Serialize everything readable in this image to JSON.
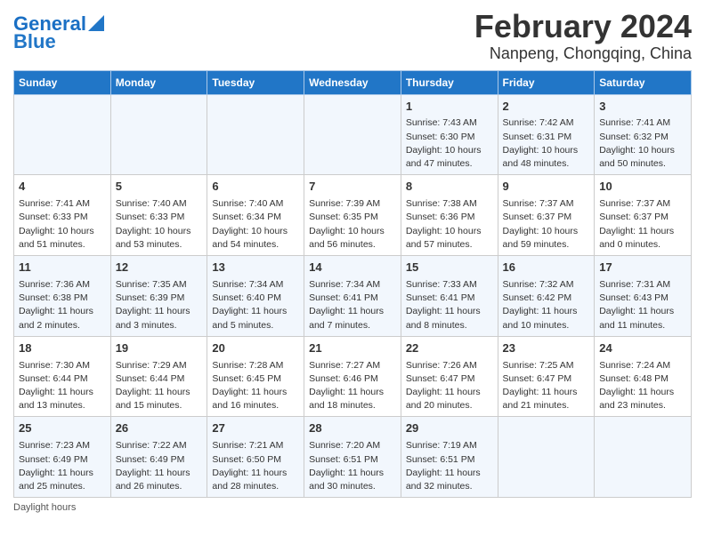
{
  "header": {
    "logo_line1": "General",
    "logo_line2": "Blue",
    "month": "February 2024",
    "location": "Nanpeng, Chongqing, China"
  },
  "days_of_week": [
    "Sunday",
    "Monday",
    "Tuesday",
    "Wednesday",
    "Thursday",
    "Friday",
    "Saturday"
  ],
  "weeks": [
    [
      {
        "day": "",
        "info": ""
      },
      {
        "day": "",
        "info": ""
      },
      {
        "day": "",
        "info": ""
      },
      {
        "day": "",
        "info": ""
      },
      {
        "day": "1",
        "info": "Sunrise: 7:43 AM\nSunset: 6:30 PM\nDaylight: 10 hours and 47 minutes."
      },
      {
        "day": "2",
        "info": "Sunrise: 7:42 AM\nSunset: 6:31 PM\nDaylight: 10 hours and 48 minutes."
      },
      {
        "day": "3",
        "info": "Sunrise: 7:41 AM\nSunset: 6:32 PM\nDaylight: 10 hours and 50 minutes."
      }
    ],
    [
      {
        "day": "4",
        "info": "Sunrise: 7:41 AM\nSunset: 6:33 PM\nDaylight: 10 hours and 51 minutes."
      },
      {
        "day": "5",
        "info": "Sunrise: 7:40 AM\nSunset: 6:33 PM\nDaylight: 10 hours and 53 minutes."
      },
      {
        "day": "6",
        "info": "Sunrise: 7:40 AM\nSunset: 6:34 PM\nDaylight: 10 hours and 54 minutes."
      },
      {
        "day": "7",
        "info": "Sunrise: 7:39 AM\nSunset: 6:35 PM\nDaylight: 10 hours and 56 minutes."
      },
      {
        "day": "8",
        "info": "Sunrise: 7:38 AM\nSunset: 6:36 PM\nDaylight: 10 hours and 57 minutes."
      },
      {
        "day": "9",
        "info": "Sunrise: 7:37 AM\nSunset: 6:37 PM\nDaylight: 10 hours and 59 minutes."
      },
      {
        "day": "10",
        "info": "Sunrise: 7:37 AM\nSunset: 6:37 PM\nDaylight: 11 hours and 0 minutes."
      }
    ],
    [
      {
        "day": "11",
        "info": "Sunrise: 7:36 AM\nSunset: 6:38 PM\nDaylight: 11 hours and 2 minutes."
      },
      {
        "day": "12",
        "info": "Sunrise: 7:35 AM\nSunset: 6:39 PM\nDaylight: 11 hours and 3 minutes."
      },
      {
        "day": "13",
        "info": "Sunrise: 7:34 AM\nSunset: 6:40 PM\nDaylight: 11 hours and 5 minutes."
      },
      {
        "day": "14",
        "info": "Sunrise: 7:34 AM\nSunset: 6:41 PM\nDaylight: 11 hours and 7 minutes."
      },
      {
        "day": "15",
        "info": "Sunrise: 7:33 AM\nSunset: 6:41 PM\nDaylight: 11 hours and 8 minutes."
      },
      {
        "day": "16",
        "info": "Sunrise: 7:32 AM\nSunset: 6:42 PM\nDaylight: 11 hours and 10 minutes."
      },
      {
        "day": "17",
        "info": "Sunrise: 7:31 AM\nSunset: 6:43 PM\nDaylight: 11 hours and 11 minutes."
      }
    ],
    [
      {
        "day": "18",
        "info": "Sunrise: 7:30 AM\nSunset: 6:44 PM\nDaylight: 11 hours and 13 minutes."
      },
      {
        "day": "19",
        "info": "Sunrise: 7:29 AM\nSunset: 6:44 PM\nDaylight: 11 hours and 15 minutes."
      },
      {
        "day": "20",
        "info": "Sunrise: 7:28 AM\nSunset: 6:45 PM\nDaylight: 11 hours and 16 minutes."
      },
      {
        "day": "21",
        "info": "Sunrise: 7:27 AM\nSunset: 6:46 PM\nDaylight: 11 hours and 18 minutes."
      },
      {
        "day": "22",
        "info": "Sunrise: 7:26 AM\nSunset: 6:47 PM\nDaylight: 11 hours and 20 minutes."
      },
      {
        "day": "23",
        "info": "Sunrise: 7:25 AM\nSunset: 6:47 PM\nDaylight: 11 hours and 21 minutes."
      },
      {
        "day": "24",
        "info": "Sunrise: 7:24 AM\nSunset: 6:48 PM\nDaylight: 11 hours and 23 minutes."
      }
    ],
    [
      {
        "day": "25",
        "info": "Sunrise: 7:23 AM\nSunset: 6:49 PM\nDaylight: 11 hours and 25 minutes."
      },
      {
        "day": "26",
        "info": "Sunrise: 7:22 AM\nSunset: 6:49 PM\nDaylight: 11 hours and 26 minutes."
      },
      {
        "day": "27",
        "info": "Sunrise: 7:21 AM\nSunset: 6:50 PM\nDaylight: 11 hours and 28 minutes."
      },
      {
        "day": "28",
        "info": "Sunrise: 7:20 AM\nSunset: 6:51 PM\nDaylight: 11 hours and 30 minutes."
      },
      {
        "day": "29",
        "info": "Sunrise: 7:19 AM\nSunset: 6:51 PM\nDaylight: 11 hours and 32 minutes."
      },
      {
        "day": "",
        "info": ""
      },
      {
        "day": "",
        "info": ""
      }
    ]
  ],
  "footer": {
    "note": "Daylight hours"
  }
}
